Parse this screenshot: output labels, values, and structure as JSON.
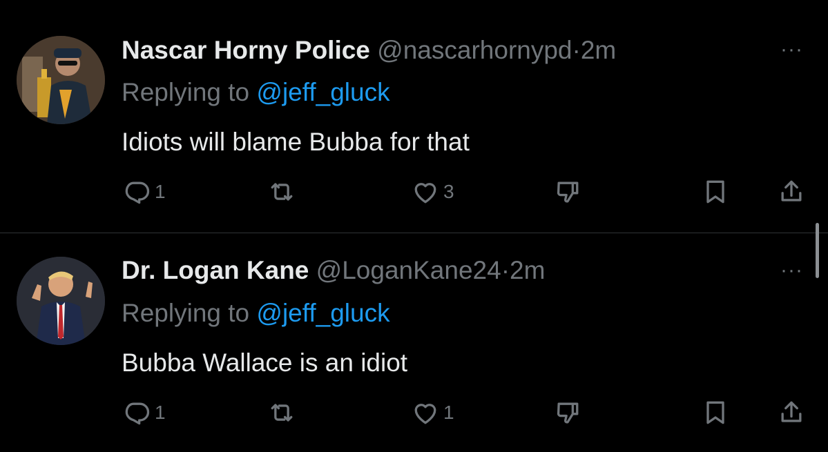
{
  "tweets": [
    {
      "display_name": "Nascar Horny Police",
      "handle": "@nascarhornypd",
      "separator": "·",
      "time": "2m",
      "replying_prefix": "Replying to ",
      "replying_to": "@jeff_gluck",
      "text": "Idiots will blame Bubba for that",
      "more_label": "···",
      "reply_count": "1",
      "retweet_count": "",
      "like_count": "3"
    },
    {
      "display_name": "Dr. Logan Kane",
      "handle": "@LoganKane24",
      "separator": "·",
      "time": "2m",
      "replying_prefix": "Replying to ",
      "replying_to": "@jeff_gluck",
      "text": "Bubba Wallace is an idiot",
      "more_label": "···",
      "reply_count": "1",
      "retweet_count": "",
      "like_count": "1"
    }
  ],
  "icons": {
    "reply": "reply-icon",
    "retweet": "retweet-icon",
    "like": "like-icon",
    "dislike": "dislike-icon",
    "bookmark": "bookmark-icon",
    "share": "share-icon",
    "more": "more-icon"
  },
  "colors": {
    "background": "#000000",
    "text": "#e7e9ea",
    "muted": "#71767b",
    "link": "#1d9bf0",
    "divider": "#2f3336"
  }
}
